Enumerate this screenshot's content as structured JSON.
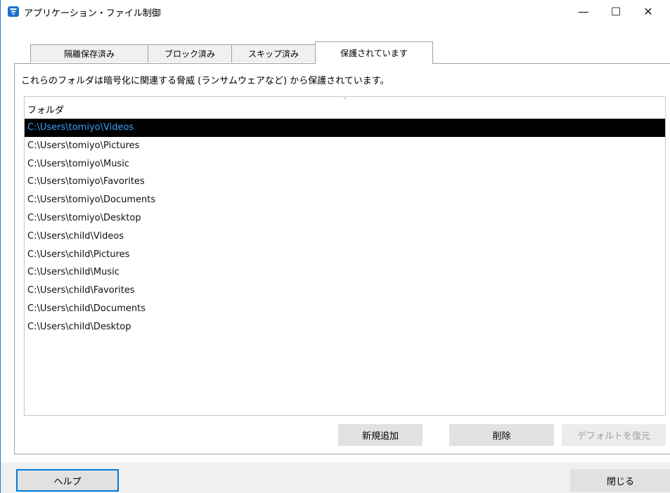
{
  "window": {
    "title": "アプリケーション・ファイル制御",
    "controls": {
      "minimize": "—",
      "maximize": "☐",
      "close": "✕"
    }
  },
  "tabs": [
    {
      "label": "隔離保存済み",
      "active": false
    },
    {
      "label": "ブロック済み",
      "active": false
    },
    {
      "label": "スキップ済み",
      "active": false
    },
    {
      "label": "保護されています",
      "active": true
    }
  ],
  "description": "これらのフォルダは暗号化に関連する脅威 (ランサムウェアなど) から保護されています。",
  "list": {
    "column_header": "フォルダ",
    "sort_indicator": "⌄",
    "rows": [
      "C:\\Users\\tomiyo\\Videos",
      "C:\\Users\\tomiyo\\Pictures",
      "C:\\Users\\tomiyo\\Music",
      "C:\\Users\\tomiyo\\Favorites",
      "C:\\Users\\tomiyo\\Documents",
      "C:\\Users\\tomiyo\\Desktop",
      "C:\\Users\\child\\Videos",
      "C:\\Users\\child\\Pictures",
      "C:\\Users\\child\\Music",
      "C:\\Users\\child\\Favorites",
      "C:\\Users\\child\\Documents",
      "C:\\Users\\child\\Desktop"
    ],
    "selected_index": 0
  },
  "buttons": {
    "add": "新規追加",
    "delete": "削除",
    "restore_default": "デフォルトを復元",
    "help": "ヘルプ",
    "close": "閉じる"
  },
  "colors": {
    "accent": "#0078d7",
    "app_icon": "#1a73c9",
    "selected_row_bg": "#000000",
    "selected_row_text": "#3aa0ff",
    "disabled_text": "#a0a0a0"
  }
}
